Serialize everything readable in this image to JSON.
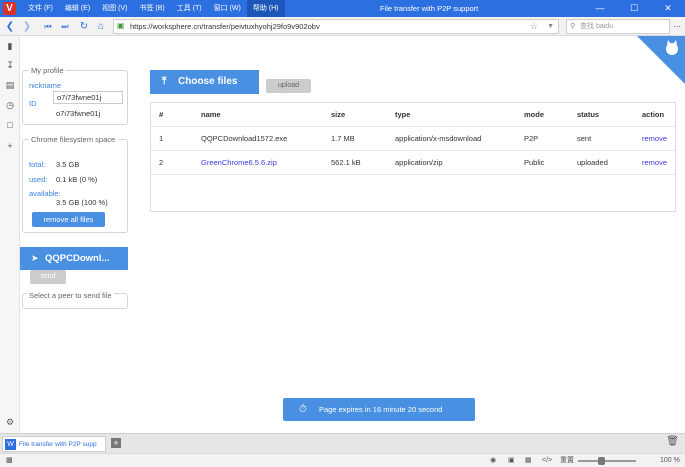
{
  "titlebar": {
    "logo": "V",
    "menu": [
      "文件 (F)",
      "编辑 (E)",
      "视图 (V)",
      "书签 (B)",
      "工具 (T)",
      "窗口 (W)",
      "帮助 (H)"
    ],
    "window_title": "File transfer with P2P support",
    "minimize": "—",
    "maximize": "☐",
    "close": "✕"
  },
  "addressbar": {
    "url": "https://worksphere.cn/transfer/peivtuxhyohj29fo9v902obv",
    "search_placeholder": "查找 baidu"
  },
  "profile": {
    "legend": "My profile",
    "nickname_label": "nickname",
    "nickname_value": "o7i73fwne01j",
    "id_label": "ID",
    "id_value": "o7i73fwne01j"
  },
  "storage": {
    "legend": "Chrome filesystem space",
    "total_label": "total:",
    "total_value": "3.5 GB",
    "used_label": "used:",
    "used_value": "0.1 kB (0 %)",
    "available_label": "available:",
    "available_value": "3.5 GB (100 %)",
    "remove_all": "remove all files"
  },
  "peer": {
    "file_name": "QQPCDownl...",
    "send_label": "send",
    "select_peer": "Select a peer to send file"
  },
  "upload": {
    "choose_label": "Choose files",
    "upload_label": "upload"
  },
  "table": {
    "headers": [
      "#",
      "name",
      "size",
      "type",
      "mode",
      "status",
      "action"
    ],
    "rows": [
      {
        "num": "1",
        "name": "QQPCDownload1572.exe",
        "size": "1.7 MB",
        "type": "application/x-msdownload",
        "mode": "P2P",
        "status": "sent",
        "action": "remove"
      },
      {
        "num": "2",
        "name": "GreenChrome6.5.6.zip",
        "size": "562.1 kB",
        "type": "application/zip",
        "mode": "Public",
        "status": "uploaded",
        "action": "remove"
      }
    ]
  },
  "expire": {
    "text": "Page expires in 16 minute 20 second"
  },
  "tabs": {
    "active_tab": "File transfer with P2P supp"
  },
  "statusbar": {
    "reset": "重置",
    "zoom": "100 %"
  },
  "colors": {
    "titlebar": "#2b6fe0",
    "accent": "#4a90e2",
    "link": "#3b3bd8"
  }
}
